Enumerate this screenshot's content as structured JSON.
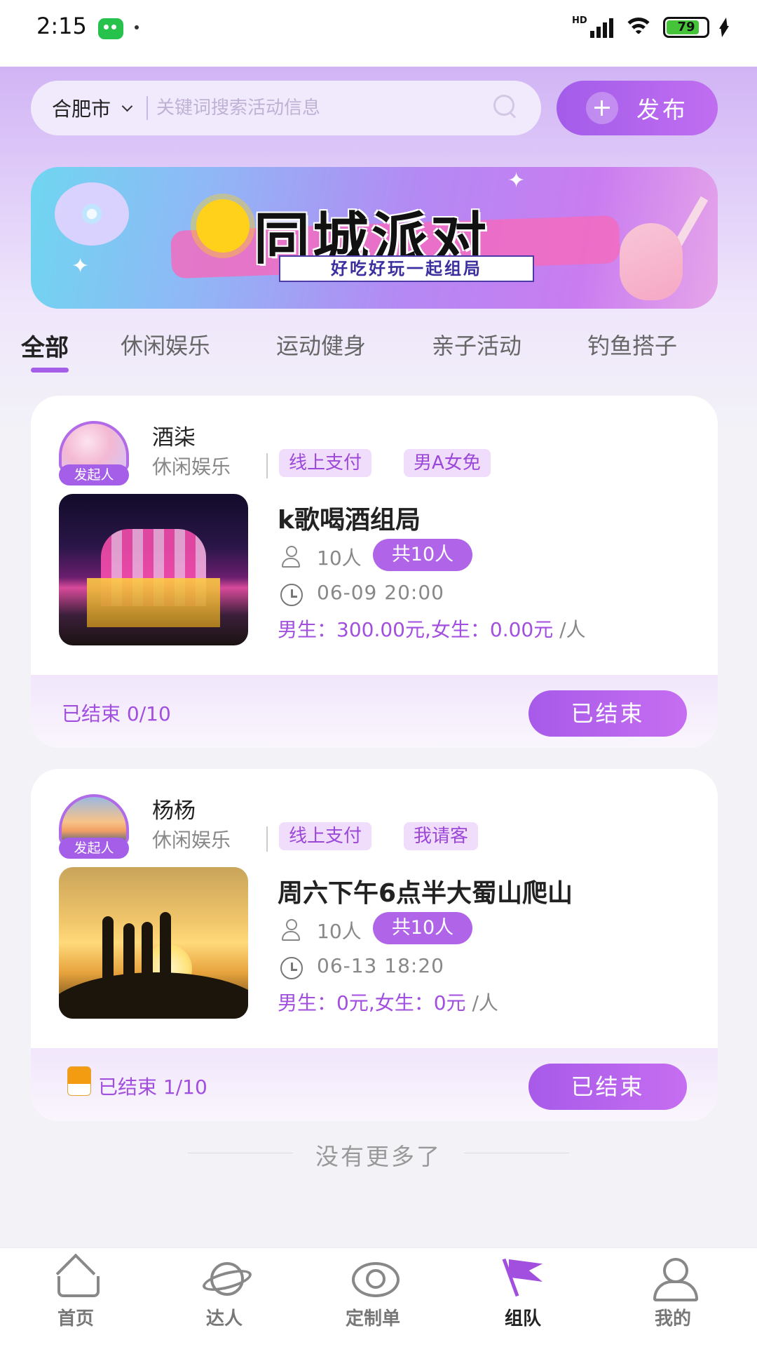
{
  "status_bar": {
    "time": "2:15",
    "battery": "79"
  },
  "search": {
    "city": "合肥市",
    "placeholder": "关键词搜索活动信息"
  },
  "publish": {
    "label": "发布"
  },
  "banner": {
    "title": "同城派对",
    "subtitle": "好吃好玩一起组局"
  },
  "tabs": [
    {
      "label": "全部",
      "active": true
    },
    {
      "label": "休闲娱乐"
    },
    {
      "label": "运动健身"
    },
    {
      "label": "亲子活动"
    },
    {
      "label": "钓鱼搭子"
    }
  ],
  "cards": [
    {
      "organizer": "酒柒",
      "role": "发起人",
      "category": "休闲娱乐",
      "tags": [
        "线上支付",
        "男A女免"
      ],
      "title": "k歌喝酒组局",
      "people": "10人",
      "total": "共10人",
      "time": "06-09 20:00",
      "price": "男生：300.00元,女生：0.00元",
      "price_unit": "/人",
      "footer_status": "已结束 0/10",
      "button": "已结束"
    },
    {
      "organizer": "杨杨",
      "role": "发起人",
      "category": "休闲娱乐",
      "tags": [
        "线上支付",
        "我请客"
      ],
      "title": "周六下午6点半大蜀山爬山",
      "people": "10人",
      "total": "共10人",
      "time": "06-13 18:20",
      "price": "男生：0元,女生：0元",
      "price_unit": "/人",
      "footer_status": "已结束 1/10",
      "button": "已结束"
    }
  ],
  "no_more": "没有更多了",
  "nav": [
    {
      "label": "首页",
      "icon": "home-icon"
    },
    {
      "label": "达人",
      "icon": "planet-icon"
    },
    {
      "label": "定制单",
      "icon": "eye-icon"
    },
    {
      "label": "组队",
      "icon": "flag-icon",
      "active": true
    },
    {
      "label": "我的",
      "icon": "user-icon"
    }
  ],
  "colors": {
    "accent": "#a45ee8",
    "price": "#a24fdf"
  }
}
